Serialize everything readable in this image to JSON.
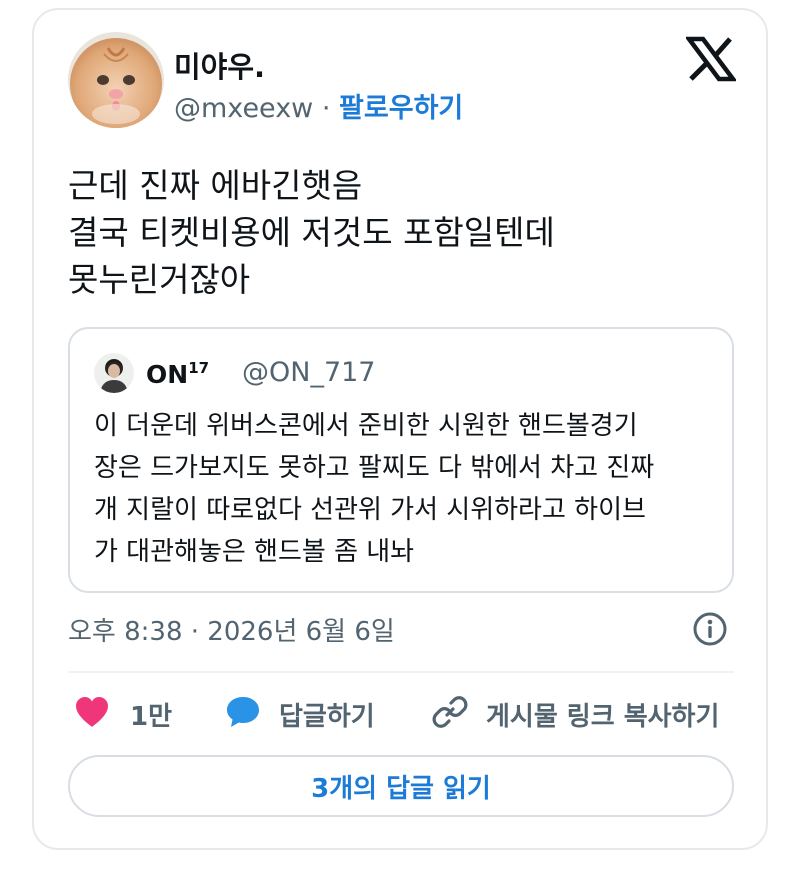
{
  "tweet": {
    "author": {
      "name": "미야우.",
      "handle": "@mxeexw",
      "separator": "·",
      "follow_label": "팔로우하기",
      "avatar": "kitten-photo"
    },
    "platform_logo": "x-logo-icon",
    "body_lines": [
      "근데 진짜 에바긴햇음",
      "결국 티켓비용에 저것도 포함일텐데",
      "못누린거잖아"
    ],
    "quoted": {
      "name": "ON",
      "name_superscript": "17",
      "handle": "@ON_717",
      "avatar": "person-photo",
      "body_lines": [
        "이 더운데 위버스콘에서 준비한 시원한 핸드볼경기",
        "장은 드가보지도 못하고 팔찌도 다 밖에서 차고 진짜",
        "개 지랄이 따로없다 선관위 가서 시위하라고 하이브",
        "가 대관해놓은 핸드볼 좀 내놔"
      ]
    },
    "timestamp": "오후 8:38 · 2026년 6월 6일",
    "actions": {
      "like_count": "1만",
      "reply_label": "답글하기",
      "copy_link_label": "게시물 링크 복사하기"
    },
    "read_replies_label": "3개의 답글 읽기"
  },
  "colors": {
    "accent": "#1d7bd8",
    "text_primary": "#0f1419",
    "text_secondary": "#536471",
    "like": "#f0367b",
    "reply": "#2b93e6",
    "border": "#d8dee3"
  },
  "icons": [
    "x-logo-icon",
    "info-icon",
    "heart-icon",
    "speech-bubble-icon",
    "link-icon"
  ]
}
